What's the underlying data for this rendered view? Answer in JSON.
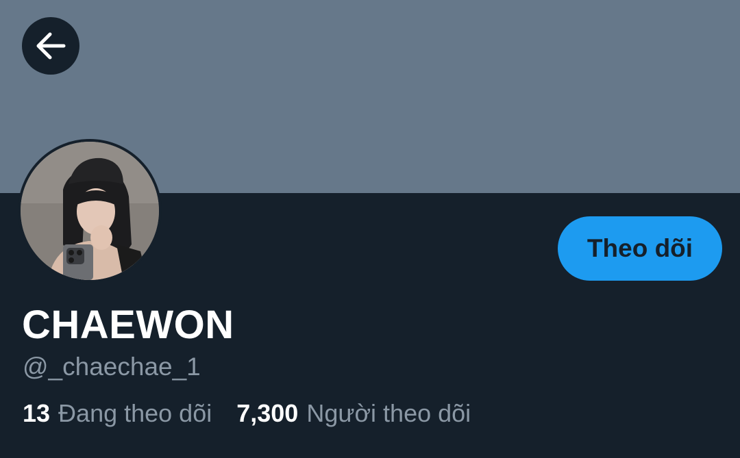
{
  "profile": {
    "display_name": "CHAEWON",
    "handle": "@_chaechae_1",
    "follow_label": "Theo dõi",
    "back_icon": "arrow-left-icon"
  },
  "stats": {
    "following_count": "13",
    "following_label": "Đang theo dõi",
    "followers_count": "7,300",
    "followers_label": "Người theo dõi"
  },
  "colors": {
    "background": "#15202b",
    "banner": "#66788a",
    "accent": "#1d9bf0",
    "secondary_text": "#8b98a5"
  }
}
